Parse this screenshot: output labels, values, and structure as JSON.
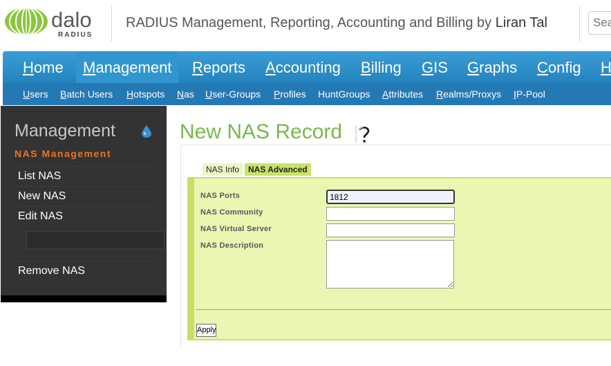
{
  "header": {
    "logo_text_top": "dalo",
    "logo_text_bottom": "RADIUS",
    "title": "RADIUS Management, Reporting, Accounting and Billing by",
    "author": "Liran Tal",
    "search_placeholder": "Search"
  },
  "main_nav": {
    "items": [
      {
        "first": "H",
        "rest": "ome"
      },
      {
        "first": "M",
        "rest": "anagement"
      },
      {
        "first": "R",
        "rest": "eports"
      },
      {
        "first": "A",
        "rest": "ccounting"
      },
      {
        "first": "B",
        "rest": "illing"
      },
      {
        "first": "G",
        "rest": "IS"
      },
      {
        "first": "G",
        "rest": "raphs"
      },
      {
        "first": "C",
        "rest": "onfig"
      },
      {
        "first": "H",
        "rest": ""
      }
    ],
    "active": "Management"
  },
  "sub_nav": {
    "items": [
      {
        "first": "U",
        "rest": "sers"
      },
      {
        "first": "B",
        "rest": "atch Users"
      },
      {
        "first": "H",
        "rest": "otspots"
      },
      {
        "first": "N",
        "rest": "as"
      },
      {
        "first": "U",
        "rest": "ser-Groups"
      },
      {
        "first": "P",
        "rest": "rofiles"
      },
      {
        "first": "",
        "rest": "HuntGroups"
      },
      {
        "first": "A",
        "rest": "ttributes"
      },
      {
        "first": "R",
        "rest": "ealms/Proxys"
      },
      {
        "first": "I",
        "rest": "P-Pool"
      }
    ]
  },
  "sidebar": {
    "title": "Management",
    "subtitle": "NAS Management",
    "items": [
      "List NAS",
      "New NAS",
      "Edit NAS",
      "Remove NAS"
    ]
  },
  "page": {
    "heading": "New NAS Record"
  },
  "tabs": {
    "info": "NAS Info",
    "advanced": "NAS Advanced"
  },
  "form": {
    "fields": [
      {
        "label": "NAS Ports",
        "value": "1812"
      },
      {
        "label": "NAS Community",
        "value": ""
      },
      {
        "label": "NAS Virtual Server",
        "value": ""
      },
      {
        "label": "NAS Description",
        "value": ""
      }
    ],
    "apply_label": "Apply"
  },
  "colors": {
    "nav_blue": "#2a8dc6",
    "subnav_blue": "#2479b4",
    "heading_green": "#77b84b",
    "form_bg": "#ebf6b3",
    "form_accent": "#c8df66",
    "sidebar_bg": "#333333",
    "sidebar_accent": "#e8742b"
  },
  "icons": {
    "logo": "dalo-globe-logo",
    "drop": "water-drop-icon",
    "help": "question-mark-icon"
  }
}
